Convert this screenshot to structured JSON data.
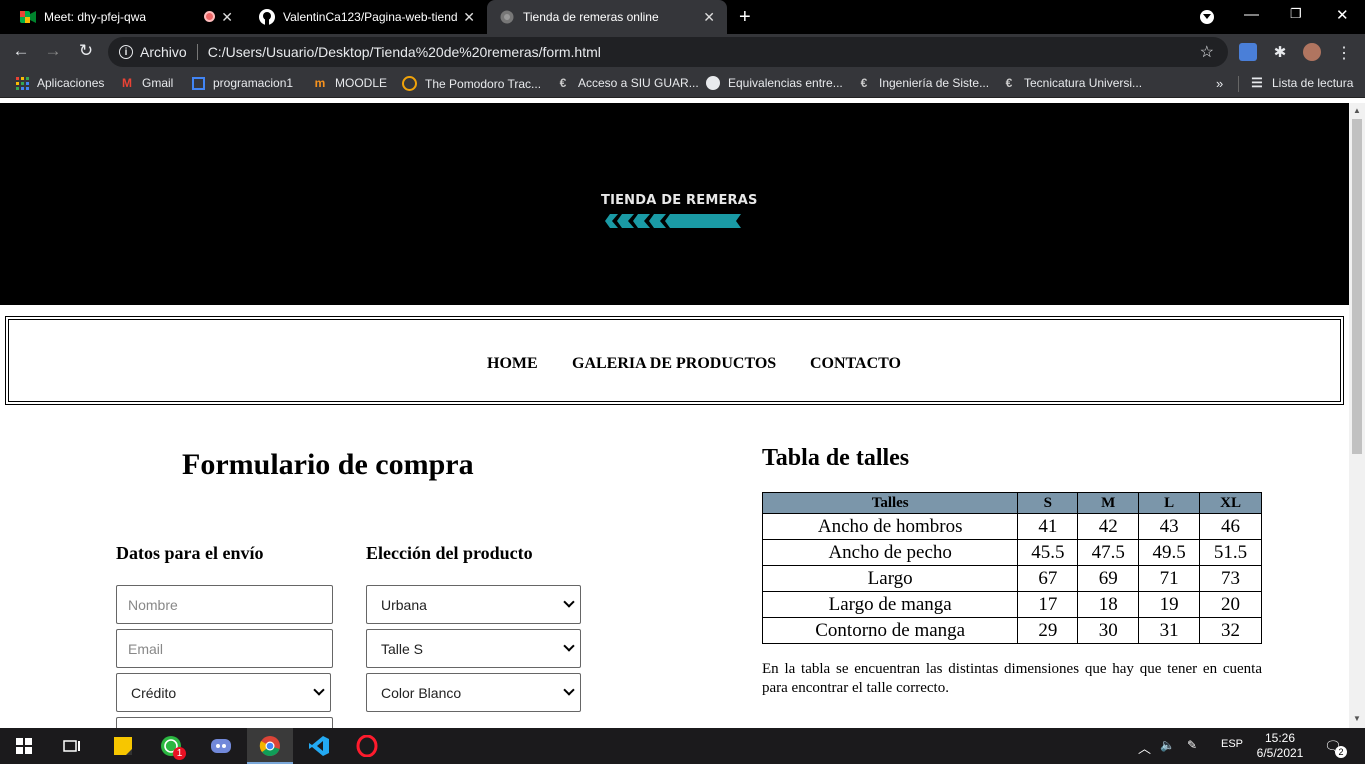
{
  "browser": {
    "tabs": [
      {
        "title": "Meet: dhy-pfej-qwa",
        "icon": "google-meet-icon",
        "recording": true
      },
      {
        "title": "ValentinCa123/Pagina-web-tiend",
        "icon": "github-icon"
      },
      {
        "title": "Tienda de remeras online",
        "icon": "globe-icon",
        "active": true
      }
    ],
    "address": {
      "scheme_label": "Archivo",
      "url": "C:/Users/Usuario/Desktop/Tienda%20de%20remeras/form.html"
    },
    "bookmarks": [
      {
        "label": "Aplicaciones",
        "icon": "apps-grid-icon"
      },
      {
        "label": "Gmail",
        "icon": "gmail-icon"
      },
      {
        "label": "programacion1",
        "icon": "classroom-icon"
      },
      {
        "label": "MOODLE",
        "icon": "moodle-icon"
      },
      {
        "label": "The Pomodoro Trac...",
        "icon": "pomodoro-icon"
      },
      {
        "label": "Acceso a SIU GUAR...",
        "icon": "siu-icon"
      },
      {
        "label": "Equivalencias entre...",
        "icon": "globe-icon"
      },
      {
        "label": "Ingeniería de Siste...",
        "icon": "siu-icon"
      },
      {
        "label": "Tecnicatura Universi...",
        "icon": "siu-icon"
      }
    ],
    "reading_list": "Lista de lectura",
    "more_bookmarks": "»"
  },
  "page": {
    "logo_text": "TIENDA DE REMERAS",
    "nav": [
      "HOME",
      "GALERIA DE PRODUCTOS",
      "CONTACTO"
    ],
    "form": {
      "title": "Formulario de compra",
      "shipping_heading": "Datos para el envío",
      "product_heading": "Elección del producto",
      "name_placeholder": "Nombre",
      "email_placeholder": "Email",
      "payment_value": "Crédito",
      "style_value": "Urbana",
      "size_value": "Talle S",
      "color_value": "Color Blanco"
    },
    "size_table": {
      "title": "Tabla de talles",
      "headers": [
        "Talles",
        "S",
        "M",
        "L",
        "XL"
      ],
      "rows": [
        [
          "Ancho de hombros",
          "41",
          "42",
          "43",
          "46"
        ],
        [
          "Ancho de pecho",
          "45.5",
          "47.5",
          "49.5",
          "51.5"
        ],
        [
          "Largo",
          "67",
          "69",
          "71",
          "73"
        ],
        [
          "Largo de manga",
          "17",
          "18",
          "19",
          "20"
        ],
        [
          "Contorno de manga",
          "29",
          "30",
          "31",
          "32"
        ]
      ],
      "note": "En la tabla se encuentran las distintas dimensiones que hay que tener en cuenta para encontrar el talle correcto."
    },
    "colors": {
      "header_bg": "#000000",
      "table_header_bg": "#7b96aa",
      "logo_accent": "#1a9aa5"
    }
  },
  "taskbar": {
    "language": "ESP",
    "time": "15:26",
    "date": "6/5/2021",
    "notifications": "2",
    "whatsapp_badge": "1"
  }
}
